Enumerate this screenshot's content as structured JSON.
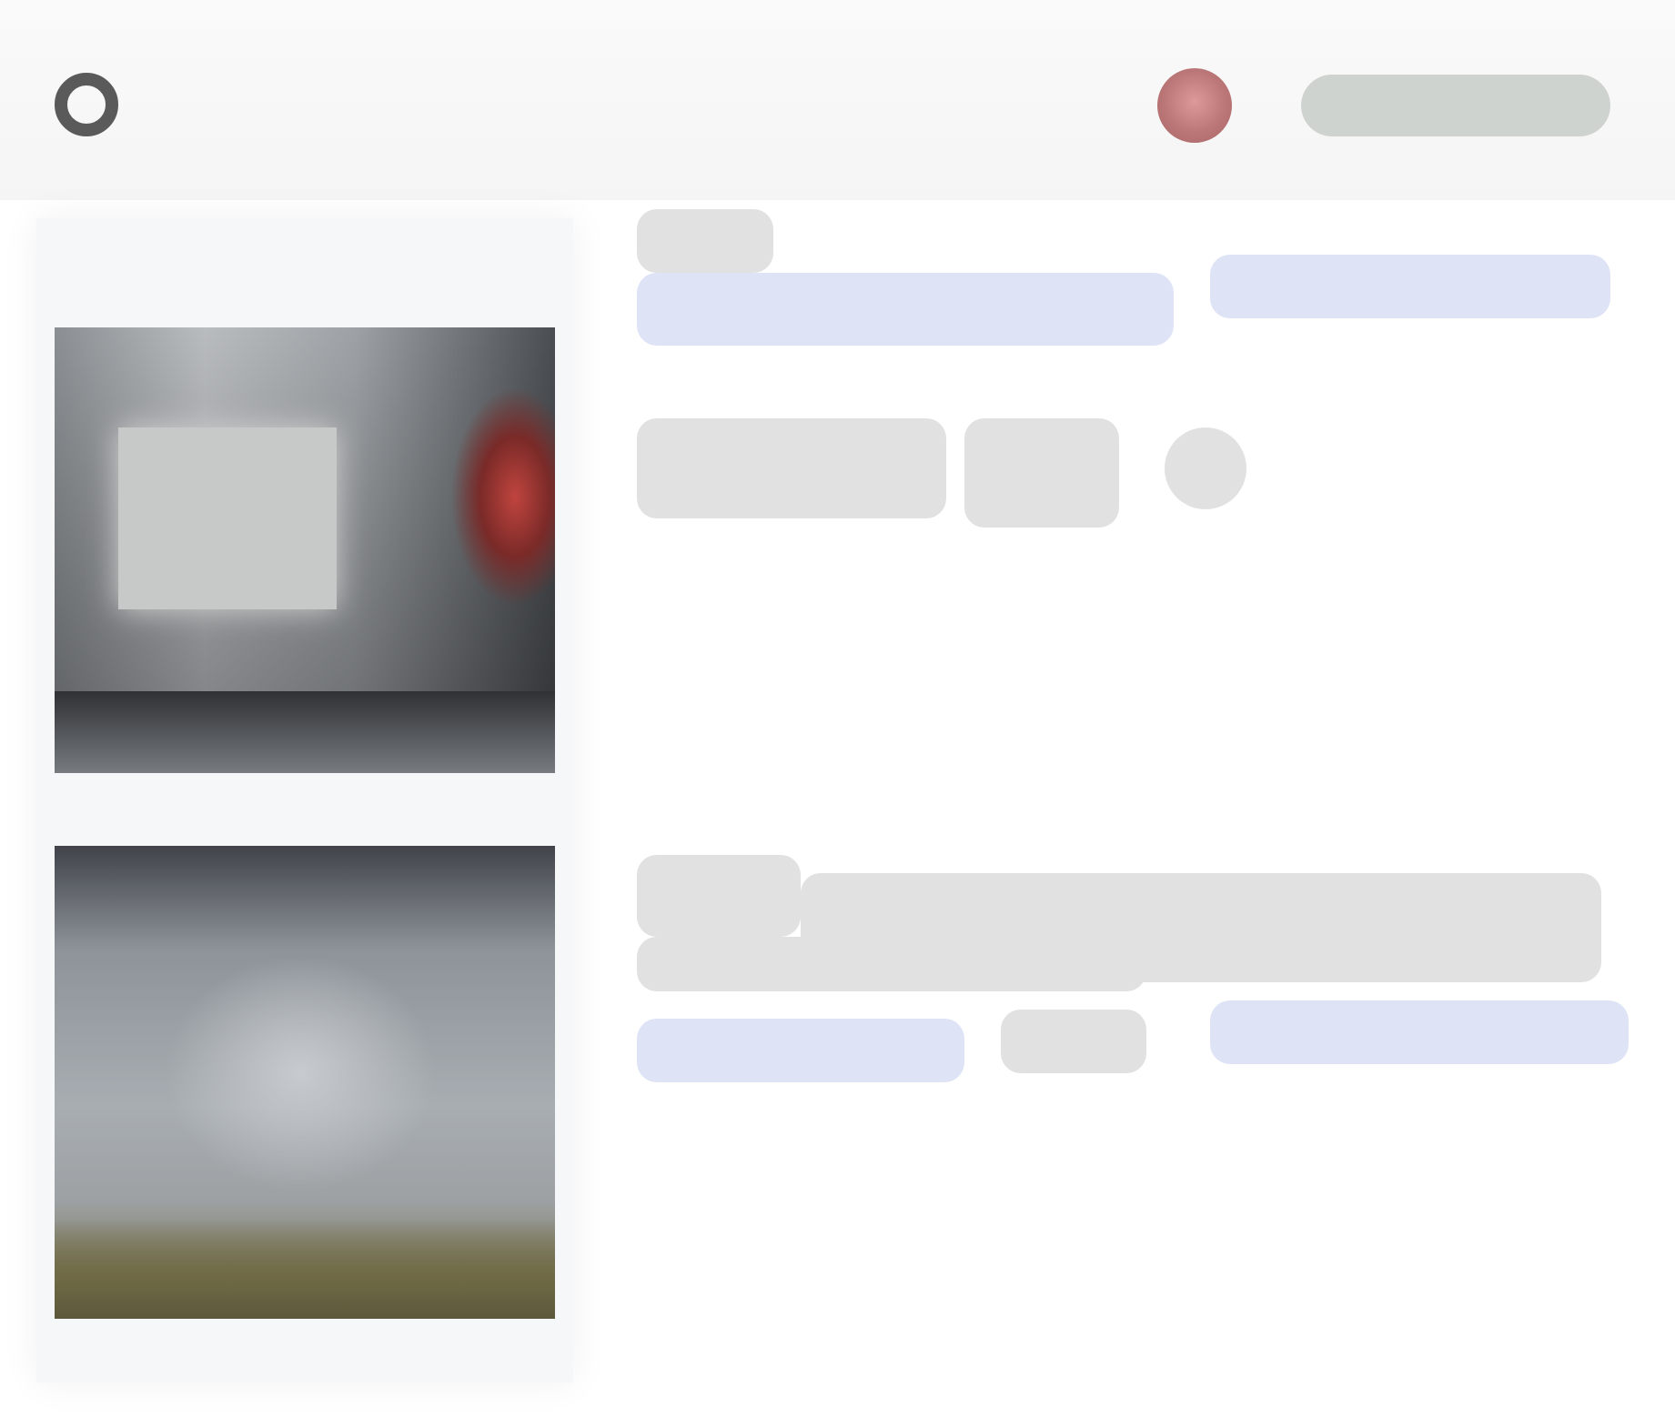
{
  "header": {
    "user_name": ""
  },
  "colors": {
    "topbar_background": "#f5f5f5",
    "placeholder_grey": "#e1e1e1",
    "link_blue_tint": "#dfe3f6",
    "avatar_accent": "#b77777"
  },
  "icons": {
    "logo": "logo-icon",
    "avatar": "avatar"
  }
}
